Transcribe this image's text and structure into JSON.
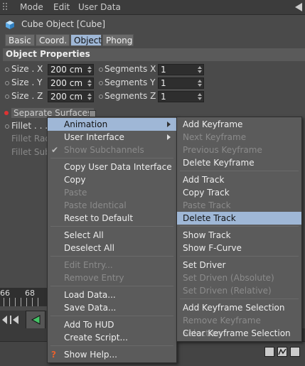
{
  "menubar": {
    "items": [
      "Mode",
      "Edit",
      "User Data"
    ]
  },
  "header": {
    "title": "Cube Object [Cube]"
  },
  "tabs": [
    "Basic",
    "Coord.",
    "Object",
    "Phong"
  ],
  "section_title": "Object Properties",
  "properties": [
    {
      "label": "Size . X",
      "value": "200 cm",
      "seg_label": "Segments X",
      "seg_value": "1"
    },
    {
      "label": "Size . Y",
      "value": "200 cm",
      "seg_label": "Segments Y",
      "seg_value": "1"
    },
    {
      "label": "Size . Z",
      "value": "200 cm",
      "seg_label": "Segments Z",
      "seg_value": "1"
    }
  ],
  "background_rows": {
    "separate_surfaces": "Separate Surfaces",
    "fillet": "Fillet . . .",
    "fillet_radius": "Fillet Rad",
    "fillet_subdivision": "Fillet Sub"
  },
  "timeline": {
    "tick_a": "66",
    "tick_b": "68"
  },
  "context_menu": {
    "items": [
      {
        "label": "Animation",
        "submenu": true,
        "highlight": true
      },
      {
        "label": "User Interface",
        "submenu": true
      },
      {
        "label": "Show Subchannels",
        "disabled": true,
        "checked": true
      },
      {
        "label": "Copy User Data Interface"
      },
      {
        "label": "Copy"
      },
      {
        "label": "Paste",
        "disabled": true
      },
      {
        "label": "Paste Identical",
        "disabled": true
      },
      {
        "label": "Reset to Default"
      },
      {
        "label": "Select All"
      },
      {
        "label": "Deselect All"
      },
      {
        "label": "Edit Entry...",
        "disabled": true
      },
      {
        "label": "Remove Entry",
        "disabled": true
      },
      {
        "label": "Load Data..."
      },
      {
        "label": "Save Data..."
      },
      {
        "label": "Add To HUD"
      },
      {
        "label": "Create Script..."
      },
      {
        "label": "Show Help..."
      }
    ]
  },
  "animation_submenu": {
    "items": [
      {
        "label": "Add Keyframe"
      },
      {
        "label": "Next Keyframe",
        "disabled": true
      },
      {
        "label": "Previous Keyframe",
        "disabled": true
      },
      {
        "label": "Delete Keyframe"
      },
      {
        "label": "Add Track"
      },
      {
        "label": "Copy Track"
      },
      {
        "label": "Paste Track",
        "disabled": true
      },
      {
        "label": "Delete Track",
        "highlight": true
      },
      {
        "label": "Show Track"
      },
      {
        "label": "Show F-Curve"
      },
      {
        "label": "Set Driver"
      },
      {
        "label": "Set Driven (Absolute)",
        "disabled": true
      },
      {
        "label": "Set Driven (Relative)",
        "disabled": true
      },
      {
        "label": "Add Keyframe Selection"
      },
      {
        "label": "Remove Keyframe Selection",
        "disabled": true
      },
      {
        "label": "Clear Keyframe Selection"
      }
    ]
  },
  "colors": {
    "highlight": "#9fb7d6",
    "panel": "#4a4a4a",
    "menu": "#5b5b5b"
  }
}
